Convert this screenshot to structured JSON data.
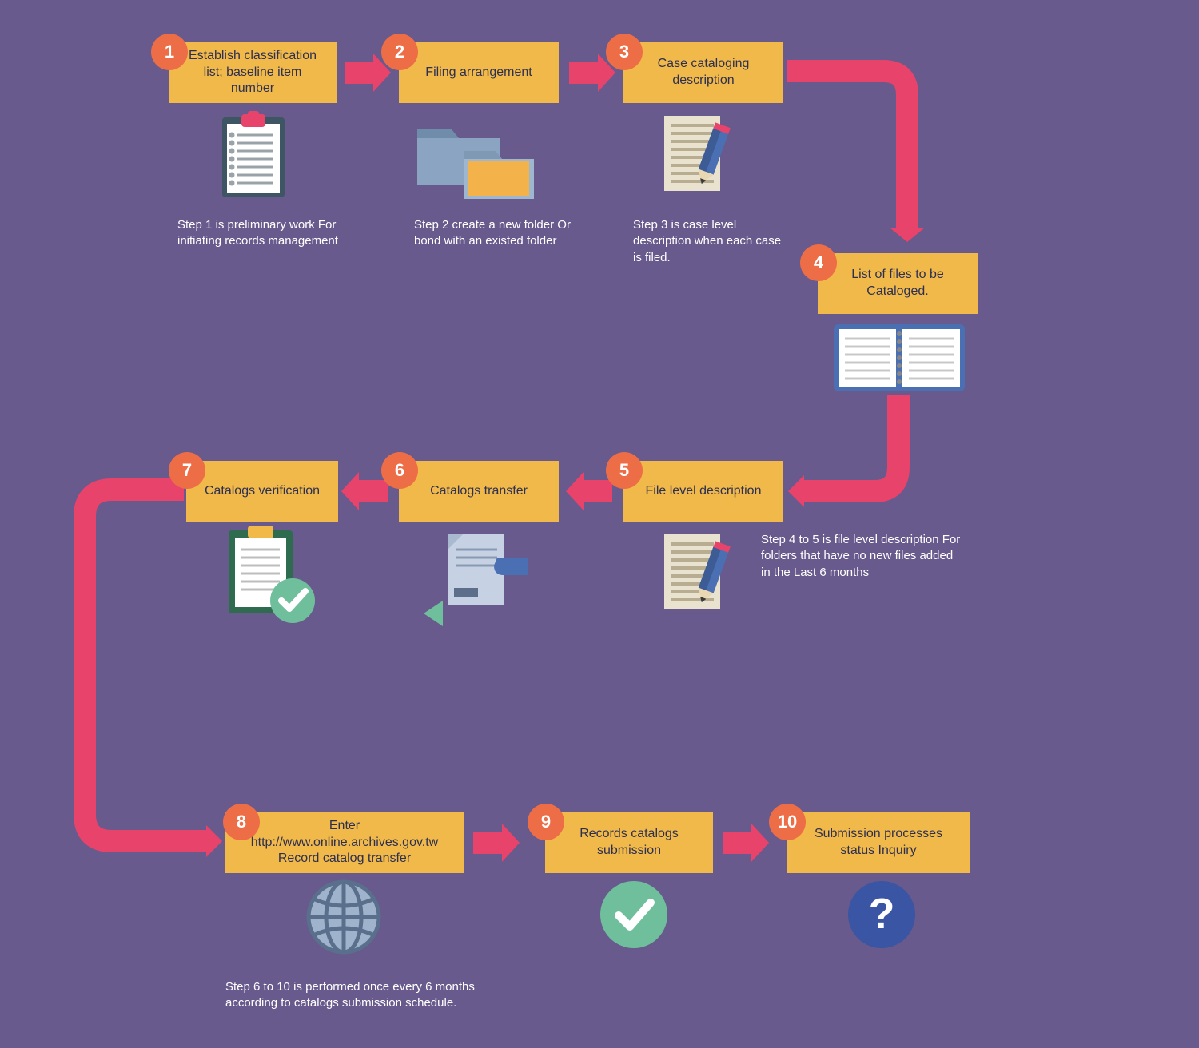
{
  "steps": {
    "s1": {
      "num": "1",
      "label": "Establish classification list; baseline item number"
    },
    "s2": {
      "num": "2",
      "label": "Filing arrangement"
    },
    "s3": {
      "num": "3",
      "label": "Case cataloging description"
    },
    "s4": {
      "num": "4",
      "label": "List of files to be Cataloged."
    },
    "s5": {
      "num": "5",
      "label": "File level description"
    },
    "s6": {
      "num": "6",
      "label": "Catalogs transfer"
    },
    "s7": {
      "num": "7",
      "label": "Catalogs verification"
    },
    "s8": {
      "num": "8",
      "label": "Enter http://www.online.archives.gov.tw Record catalog transfer"
    },
    "s9": {
      "num": "9",
      "label": "Records catalogs submission"
    },
    "s10": {
      "num": "10",
      "label": "Submission processes status Inquiry"
    }
  },
  "captions": {
    "c1": "Step 1 is preliminary work For initiating records management",
    "c2": "Step 2 create a new folder Or bond with an existed folder",
    "c3": "Step 3 is case level description when each case is filed.",
    "c5": "Step 4 to 5 is file level description For folders that have no new files added in the Last 6 months",
    "c8": "Step 6 to 10 is performed once every 6 months according to catalogs submission schedule."
  }
}
